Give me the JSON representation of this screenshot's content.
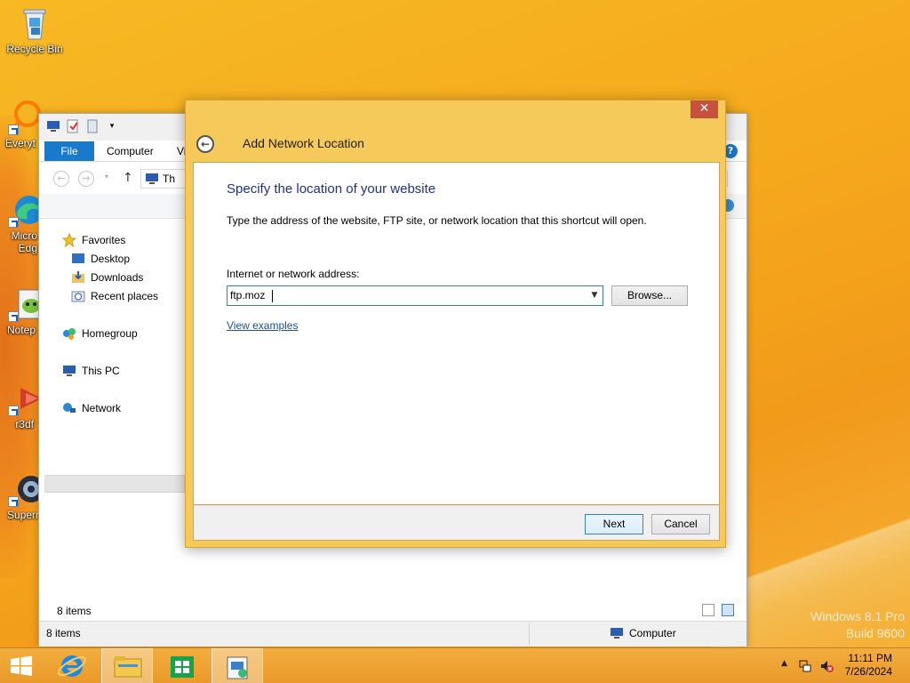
{
  "desktop": {
    "icons": [
      {
        "label": "Recycle Bin"
      },
      {
        "label": "Everyt"
      },
      {
        "label": "Micro Edg"
      },
      {
        "label": "Notep"
      },
      {
        "label": "r3df"
      },
      {
        "label": "Superr"
      }
    ],
    "watermark": {
      "line1": "Windows 8.1 Pro",
      "line2": "Build 9600"
    }
  },
  "explorer": {
    "tabs": {
      "file": "File",
      "computer": "Computer",
      "view": "Vi"
    },
    "address": "Th",
    "nav": {
      "favorites": "Favorites",
      "desktop": "Desktop",
      "downloads": "Downloads",
      "recent": "Recent places",
      "homegroup": "Homegroup",
      "this_pc": "This PC",
      "network": "Network"
    },
    "status_items": "8 items",
    "statusbar_items": "8 items",
    "statusbar_location": "Computer"
  },
  "dialog": {
    "title": "Add Network Location",
    "close_glyph": "✕",
    "heading": "Specify the location of your website",
    "description": "Type the address of the website, FTP site, or network location that this shortcut will open.",
    "field_label": "Internet or network address:",
    "address_value": "ftp.moz",
    "browse_label": "Browse...",
    "examples_link": "View examples",
    "next_label": "Next",
    "cancel_label": "Cancel"
  },
  "taskbar": {
    "time": "11:11 PM",
    "date": "7/26/2024"
  },
  "colors": {
    "desktop": "#f5a81c",
    "dialog_frame": "#f5c95a",
    "heading": "#1e3287",
    "file_tab": "#1979ca",
    "close_button": "#c7503f"
  }
}
